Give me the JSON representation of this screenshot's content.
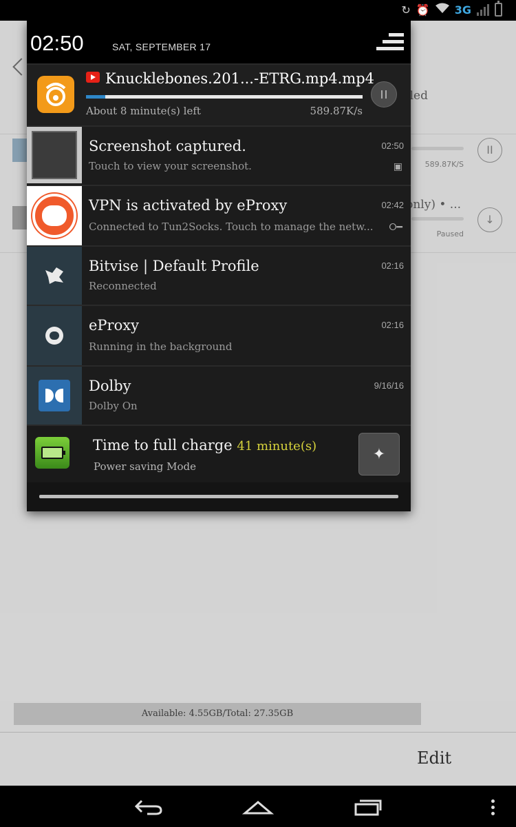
{
  "status_bar": {
    "network": "3G"
  },
  "shade": {
    "time": "02:50",
    "date": "SAT, SEPTEMBER 17"
  },
  "download": {
    "title": "Knucklebones.201...-ETRG.mp4.mp4",
    "time_left": "About 8 minute(s) left",
    "speed": "589.87K/s",
    "progress": 0.07
  },
  "notifications": [
    {
      "title": "Screenshot captured.",
      "subtitle": "Touch to view your screenshot.",
      "time": "02:50"
    },
    {
      "title": "VPN is activated by eProxy",
      "subtitle": "Connected to Tun2Socks. Touch to manage the netw...",
      "time": "02:42"
    },
    {
      "title": "Bitvise | Default Profile",
      "subtitle": "Reconnected",
      "time": "02:16"
    },
    {
      "title": "eProxy",
      "subtitle": "Running in the background",
      "time": "02:16"
    },
    {
      "title": "Dolby",
      "subtitle": "Dolby On",
      "time": "9/16/16"
    }
  ],
  "battery": {
    "title": "Time to full charge",
    "value": "41 minute(s)",
    "subtitle": "Power saving Mode"
  },
  "background_app": {
    "row1_status": "led",
    "row1_speed": "589.87K/S",
    "row2_title": "only) • ...",
    "row2_status": "Paused",
    "storage": "Available: 4.55GB/Total: 27.35GB",
    "edit_label": "Edit"
  }
}
